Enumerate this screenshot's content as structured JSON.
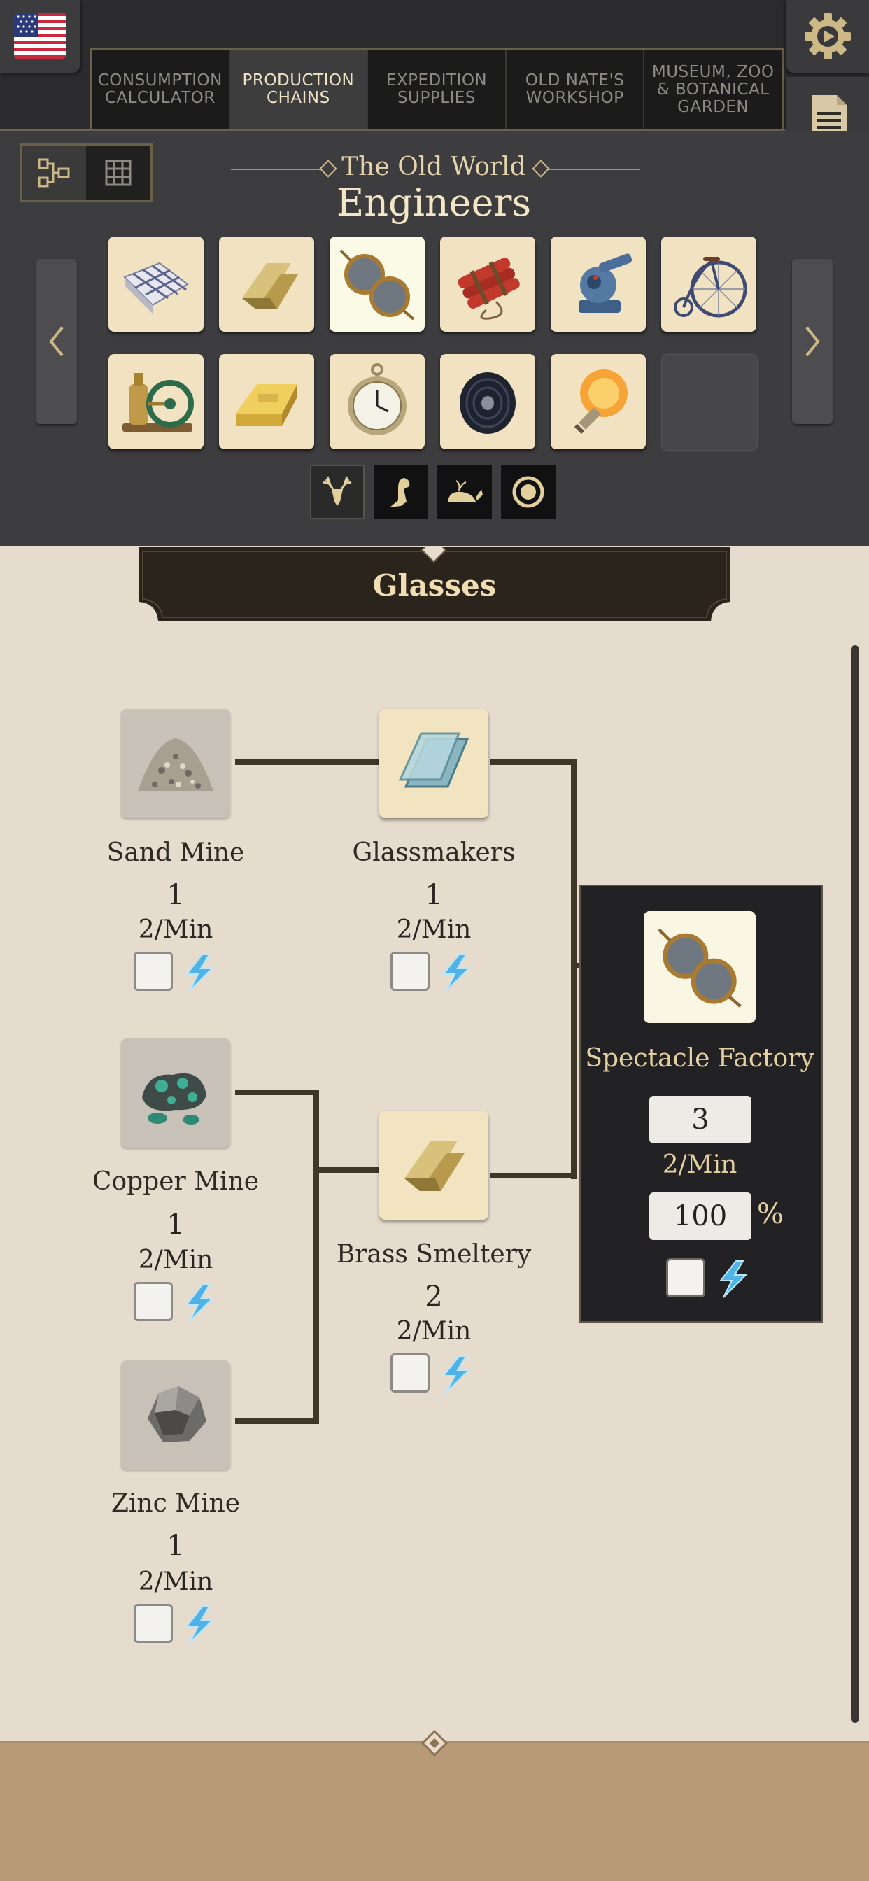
{
  "tabs": [
    {
      "label": "CONSUMPTION\nCALCULATOR",
      "active": false
    },
    {
      "label": "PRODUCTION\nCHAINS",
      "active": true
    },
    {
      "label": "EXPEDITION\nSUPPLIES",
      "active": false
    },
    {
      "label": "OLD NATE'S\nWORKSHOP",
      "active": false
    },
    {
      "label": "MUSEUM, ZOO\n& BOTANICAL\nGARDEN",
      "active": false
    }
  ],
  "icons": {
    "language": "us-flag-icon",
    "settings": "gear-play-icon",
    "notes": "document-icon",
    "view_chain": "chain-tree-icon",
    "view_grid": "grid-icon"
  },
  "header": {
    "region": "The Old World",
    "population": "Engineers"
  },
  "products": [
    {
      "name": "reinforced-concrete-icon",
      "selected": false
    },
    {
      "name": "brass-icon",
      "selected": false
    },
    {
      "name": "glasses-icon",
      "selected": true
    },
    {
      "name": "dynamite-icon",
      "selected": false
    },
    {
      "name": "advanced-weapons-icon",
      "selected": false
    },
    {
      "name": "penny-farthing-icon",
      "selected": false
    },
    {
      "name": "steam-motor-icon",
      "selected": false
    },
    {
      "name": "gold-icon",
      "selected": false
    },
    {
      "name": "pocket-watch-icon",
      "selected": false
    },
    {
      "name": "filament-icon",
      "selected": false
    },
    {
      "name": "light-bulb-icon",
      "selected": false
    },
    {
      "name": "empty-slot",
      "selected": false
    }
  ],
  "filters": [
    "deer-icon",
    "bird-icon",
    "whale-icon",
    "lion-icon"
  ],
  "chain": {
    "title": "Glasses",
    "nodes": {
      "sand_mine": {
        "name": "Sand Mine",
        "count": "1",
        "rate": "2/Min"
      },
      "glassmakers": {
        "name": "Glassmakers",
        "count": "1",
        "rate": "2/Min"
      },
      "copper_mine": {
        "name": "Copper Mine",
        "count": "1",
        "rate": "2/Min"
      },
      "brass_smeltery": {
        "name": "Brass Smeltery",
        "count": "2",
        "rate": "2/Min"
      },
      "zinc_mine": {
        "name": "Zinc Mine",
        "count": "1",
        "rate": "2/Min"
      }
    },
    "final": {
      "name": "Spectacle Factory",
      "count": "3",
      "rate": "2/Min",
      "productivity": "100",
      "unit": "%"
    }
  },
  "colors": {
    "header_bg": "#2b2b2d",
    "panel_bg": "#3d3d3f",
    "product_tile": "#f1e3c2",
    "chain_bg": "#e5dccd",
    "banner": "#2a241c",
    "accent_gold": "#e5d1a0",
    "electricity": "#4fb3e8"
  }
}
